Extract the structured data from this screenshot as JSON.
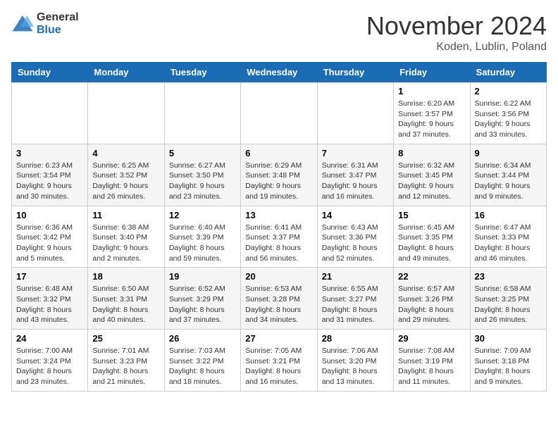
{
  "header": {
    "logo_general": "General",
    "logo_blue": "Blue",
    "month_title": "November 2024",
    "subtitle": "Koden, Lublin, Poland"
  },
  "weekdays": [
    "Sunday",
    "Monday",
    "Tuesday",
    "Wednesday",
    "Thursday",
    "Friday",
    "Saturday"
  ],
  "weeks": [
    [
      {
        "day": "",
        "info": ""
      },
      {
        "day": "",
        "info": ""
      },
      {
        "day": "",
        "info": ""
      },
      {
        "day": "",
        "info": ""
      },
      {
        "day": "",
        "info": ""
      },
      {
        "day": "1",
        "info": "Sunrise: 6:20 AM\nSunset: 3:57 PM\nDaylight: 9 hours\nand 37 minutes."
      },
      {
        "day": "2",
        "info": "Sunrise: 6:22 AM\nSunset: 3:56 PM\nDaylight: 9 hours\nand 33 minutes."
      }
    ],
    [
      {
        "day": "3",
        "info": "Sunrise: 6:23 AM\nSunset: 3:54 PM\nDaylight: 9 hours\nand 30 minutes."
      },
      {
        "day": "4",
        "info": "Sunrise: 6:25 AM\nSunset: 3:52 PM\nDaylight: 9 hours\nand 26 minutes."
      },
      {
        "day": "5",
        "info": "Sunrise: 6:27 AM\nSunset: 3:50 PM\nDaylight: 9 hours\nand 23 minutes."
      },
      {
        "day": "6",
        "info": "Sunrise: 6:29 AM\nSunset: 3:48 PM\nDaylight: 9 hours\nand 19 minutes."
      },
      {
        "day": "7",
        "info": "Sunrise: 6:31 AM\nSunset: 3:47 PM\nDaylight: 9 hours\nand 16 minutes."
      },
      {
        "day": "8",
        "info": "Sunrise: 6:32 AM\nSunset: 3:45 PM\nDaylight: 9 hours\nand 12 minutes."
      },
      {
        "day": "9",
        "info": "Sunrise: 6:34 AM\nSunset: 3:44 PM\nDaylight: 9 hours\nand 9 minutes."
      }
    ],
    [
      {
        "day": "10",
        "info": "Sunrise: 6:36 AM\nSunset: 3:42 PM\nDaylight: 9 hours\nand 5 minutes."
      },
      {
        "day": "11",
        "info": "Sunrise: 6:38 AM\nSunset: 3:40 PM\nDaylight: 9 hours\nand 2 minutes."
      },
      {
        "day": "12",
        "info": "Sunrise: 6:40 AM\nSunset: 3:39 PM\nDaylight: 8 hours\nand 59 minutes."
      },
      {
        "day": "13",
        "info": "Sunrise: 6:41 AM\nSunset: 3:37 PM\nDaylight: 8 hours\nand 56 minutes."
      },
      {
        "day": "14",
        "info": "Sunrise: 6:43 AM\nSunset: 3:36 PM\nDaylight: 8 hours\nand 52 minutes."
      },
      {
        "day": "15",
        "info": "Sunrise: 6:45 AM\nSunset: 3:35 PM\nDaylight: 8 hours\nand 49 minutes."
      },
      {
        "day": "16",
        "info": "Sunrise: 6:47 AM\nSunset: 3:33 PM\nDaylight: 8 hours\nand 46 minutes."
      }
    ],
    [
      {
        "day": "17",
        "info": "Sunrise: 6:48 AM\nSunset: 3:32 PM\nDaylight: 8 hours\nand 43 minutes."
      },
      {
        "day": "18",
        "info": "Sunrise: 6:50 AM\nSunset: 3:31 PM\nDaylight: 8 hours\nand 40 minutes."
      },
      {
        "day": "19",
        "info": "Sunrise: 6:52 AM\nSunset: 3:29 PM\nDaylight: 8 hours\nand 37 minutes."
      },
      {
        "day": "20",
        "info": "Sunrise: 6:53 AM\nSunset: 3:28 PM\nDaylight: 8 hours\nand 34 minutes."
      },
      {
        "day": "21",
        "info": "Sunrise: 6:55 AM\nSunset: 3:27 PM\nDaylight: 8 hours\nand 31 minutes."
      },
      {
        "day": "22",
        "info": "Sunrise: 6:57 AM\nSunset: 3:26 PM\nDaylight: 8 hours\nand 29 minutes."
      },
      {
        "day": "23",
        "info": "Sunrise: 6:58 AM\nSunset: 3:25 PM\nDaylight: 8 hours\nand 26 minutes."
      }
    ],
    [
      {
        "day": "24",
        "info": "Sunrise: 7:00 AM\nSunset: 3:24 PM\nDaylight: 8 hours\nand 23 minutes."
      },
      {
        "day": "25",
        "info": "Sunrise: 7:01 AM\nSunset: 3:23 PM\nDaylight: 8 hours\nand 21 minutes."
      },
      {
        "day": "26",
        "info": "Sunrise: 7:03 AM\nSunset: 3:22 PM\nDaylight: 8 hours\nand 18 minutes."
      },
      {
        "day": "27",
        "info": "Sunrise: 7:05 AM\nSunset: 3:21 PM\nDaylight: 8 hours\nand 16 minutes."
      },
      {
        "day": "28",
        "info": "Sunrise: 7:06 AM\nSunset: 3:20 PM\nDaylight: 8 hours\nand 13 minutes."
      },
      {
        "day": "29",
        "info": "Sunrise: 7:08 AM\nSunset: 3:19 PM\nDaylight: 8 hours\nand 11 minutes."
      },
      {
        "day": "30",
        "info": "Sunrise: 7:09 AM\nSunset: 3:18 PM\nDaylight: 8 hours\nand 9 minutes."
      }
    ]
  ]
}
